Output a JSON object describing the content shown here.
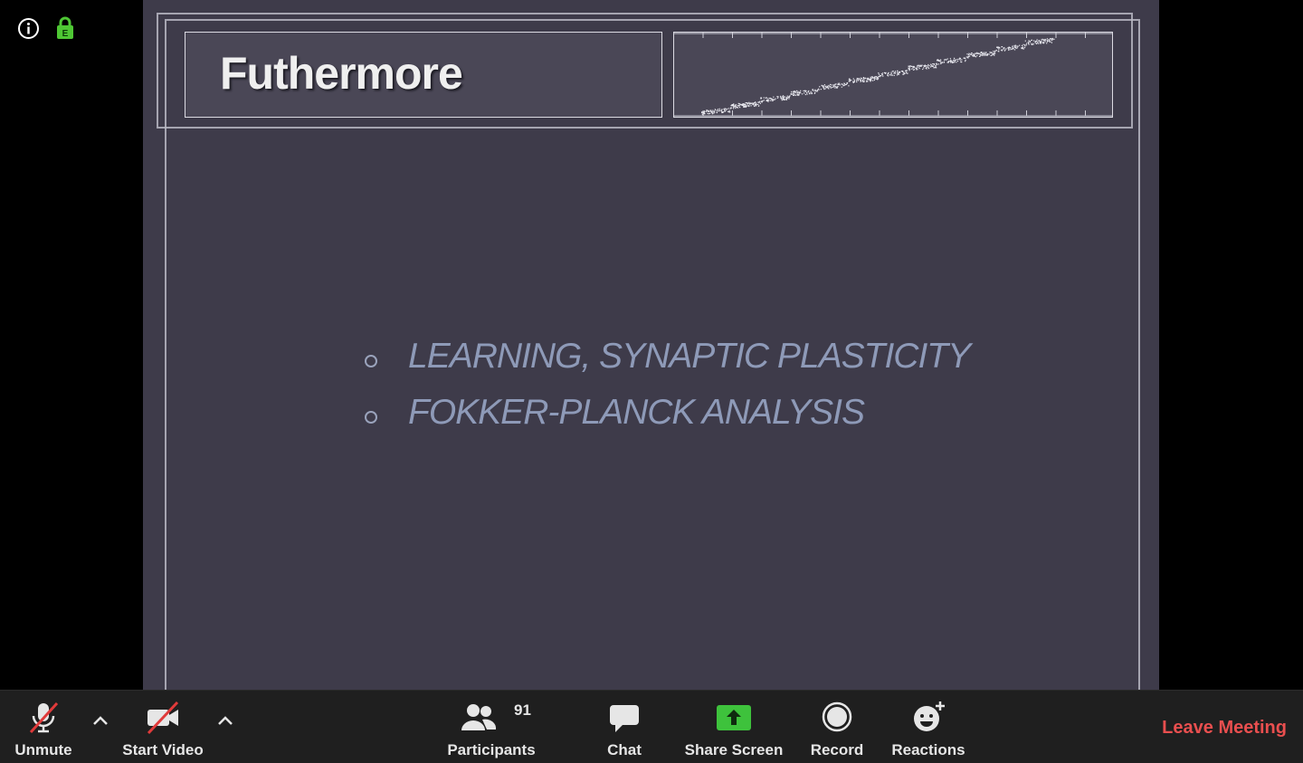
{
  "slide": {
    "title": "Futhermore",
    "bullets": [
      "LEARNING, SYNAPTIC PLASTICITY",
      "FOKKER-PLANCK ANALYSIS"
    ]
  },
  "toolbar": {
    "unmute_label": "Unmute",
    "start_video_label": "Start Video",
    "participants_label": "Participants",
    "participants_count": "91",
    "chat_label": "Chat",
    "share_screen_label": "Share Screen",
    "record_label": "Record",
    "reactions_label": "Reactions",
    "leave_label": "Leave Meeting"
  },
  "icons": {
    "info": "info-icon",
    "lock": "encrypted-lock-icon",
    "lock_letter": "E",
    "mic": "muted-mic-icon",
    "video": "video-off-icon",
    "participants": "participants-icon",
    "chat": "chat-bubble-icon",
    "share": "share-screen-icon",
    "record": "record-icon",
    "reactions": "reactions-icon"
  },
  "colors": {
    "lock_green": "#4ec734",
    "share_green": "#3ec23c",
    "leave_red": "#e94f4f",
    "toolbar_bg": "#1f1f1f",
    "slide_bg": "#3e3b4a"
  }
}
